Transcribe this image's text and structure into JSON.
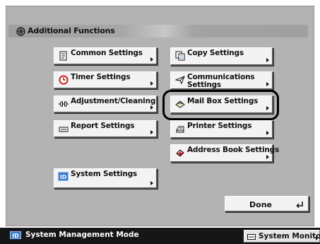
{
  "header": {
    "title": "Additional Functions",
    "icon": "additional-functions-icon"
  },
  "buttons": {
    "common": {
      "label": "Common Settings",
      "icon": "document-icon"
    },
    "timer": {
      "label": "Timer Settings",
      "icon": "clock-icon"
    },
    "adjustment": {
      "label": "Adjustment/Cleaning",
      "icon": "adjust-icon"
    },
    "report": {
      "label": "Report Settings",
      "icon": "report-icon"
    },
    "system": {
      "label": "System Settings",
      "icon": "id-icon",
      "icon_text": "ID"
    },
    "copy": {
      "label": "Copy Settings",
      "icon": "copy-icon"
    },
    "communications": {
      "line1": "Communications",
      "line2": "Settings",
      "icon": "paper-plane-icon"
    },
    "mailbox": {
      "label": "Mail Box Settings",
      "icon": "mailbox-icon",
      "highlighted": true
    },
    "printer": {
      "label": "Printer Settings",
      "icon": "printer-icon"
    },
    "address_book": {
      "label": "Address Book Settings",
      "icon": "address-book-icon"
    }
  },
  "done": {
    "label": "Done",
    "icon": "enter-icon"
  },
  "status_bar": {
    "id_badge": "ID",
    "mode_text": "System Management Mode",
    "system_monitor_label": "System Monitor"
  },
  "colors": {
    "panel": "#b3b3b3",
    "button_face": "#f3f3f3",
    "status_bar": "#161616",
    "id_badge": "#3a78c8",
    "timer_icon": "#d21e1e",
    "address_book_icon": "#c81e1e"
  }
}
